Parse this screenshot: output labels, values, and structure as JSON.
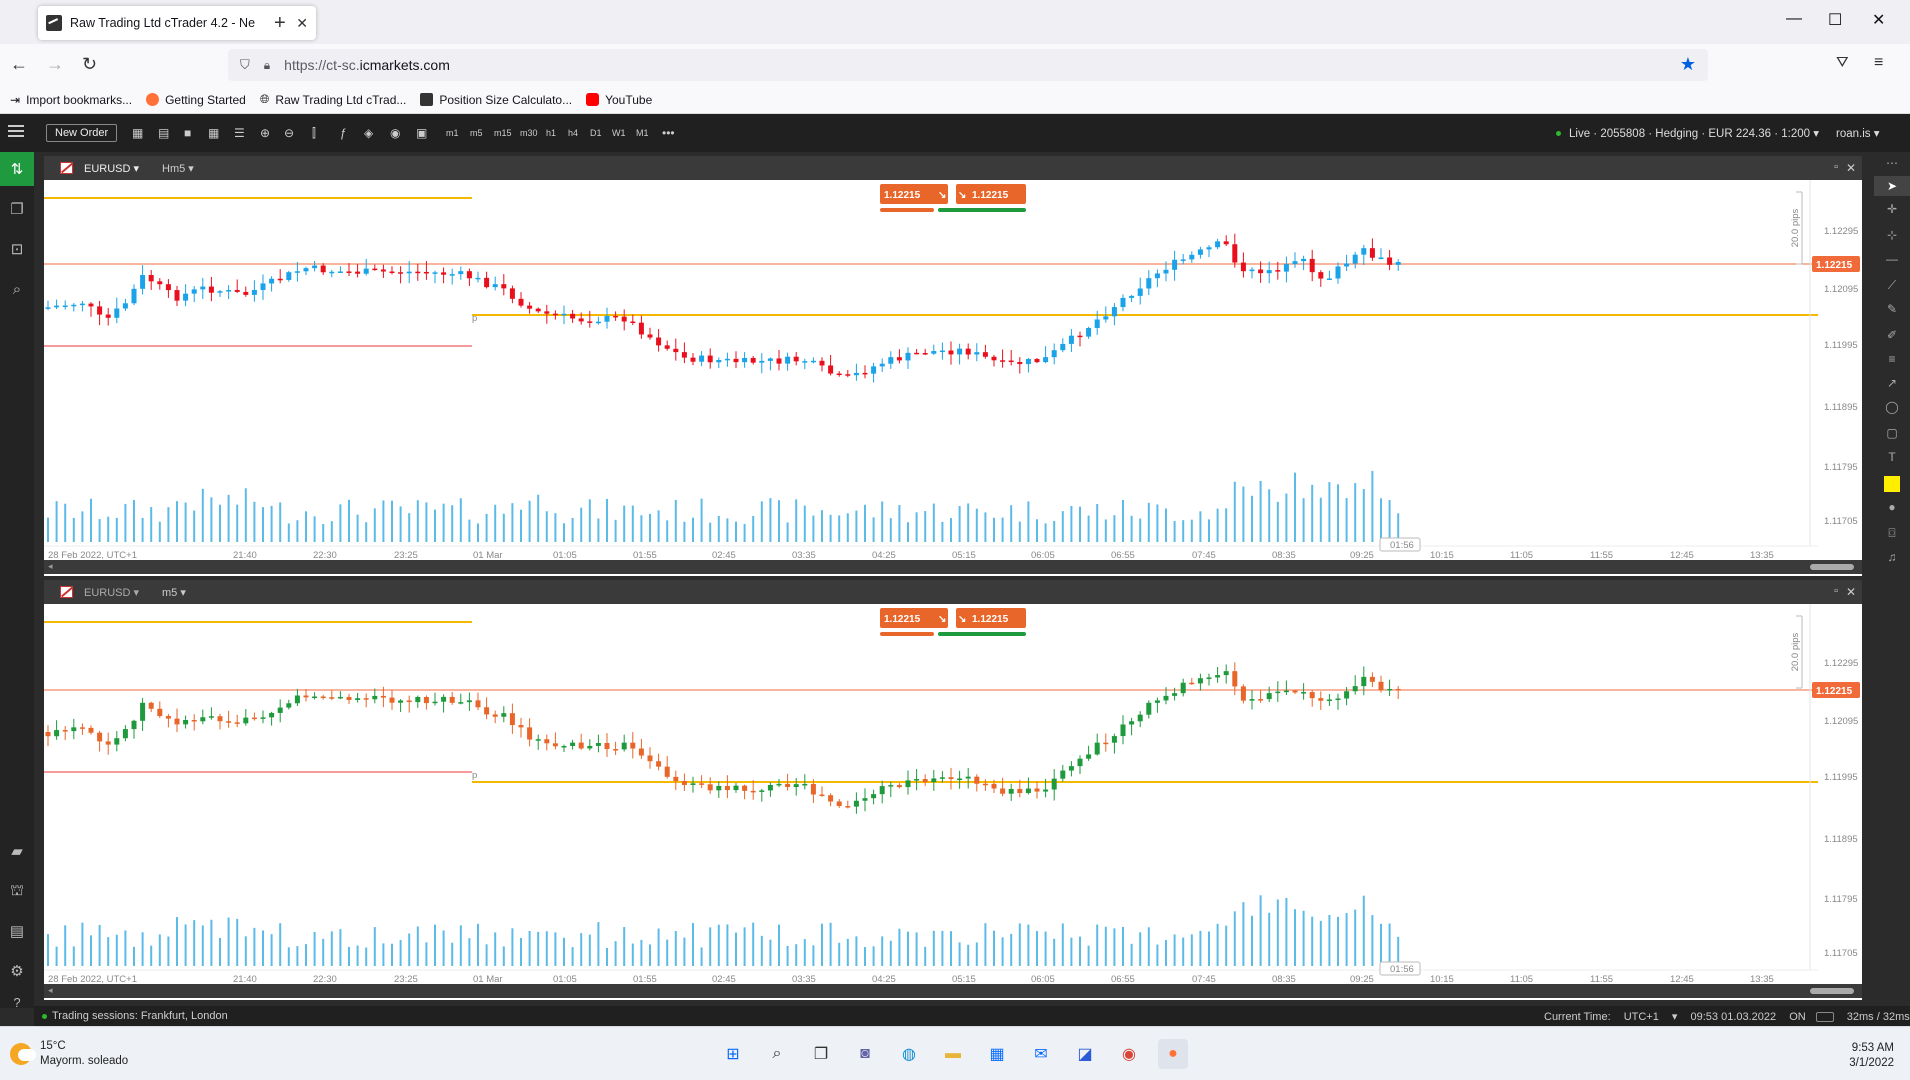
{
  "browser": {
    "tab_title": "Raw Trading Ltd cTrader 4.2 - Ne",
    "url_prefix": "https://ct-sc.",
    "url_domain": "icmarkets.com",
    "bookmarks": [
      "Import bookmarks...",
      "Getting Started",
      "Raw Trading Ltd cTrad...",
      "Position Size Calculato...",
      "YouTube"
    ]
  },
  "toolbar": {
    "new_order": "New Order",
    "timeframes": [
      "m1",
      "m5",
      "m15",
      "m30",
      "h1",
      "h4",
      "D1",
      "W1",
      "M1"
    ],
    "more": "•••",
    "account": "Live · 2055808 · Hedging · EUR 224.36 · 1:200",
    "user": "roan.is"
  },
  "charts": [
    {
      "symbol": "EURUSD",
      "timeframe": "Hm5",
      "bid_box": "1.12215",
      "ask_box": "1.12215",
      "current_price": "1.12215",
      "pips_label": "20.0 pips",
      "countdown": "01:56",
      "date_label": "28 Feb 2022, UTC+1",
      "price_ticks": [
        "1.12295",
        "1.12095",
        "1.11995",
        "1.11895",
        "1.11795",
        "1.11705"
      ],
      "time_ticks": [
        "21:40",
        "22:30",
        "23:25",
        "01 Mar",
        "01:05",
        "01:55",
        "02:45",
        "03:35",
        "04:25",
        "05:15",
        "06:05",
        "06:55",
        "07:45",
        "08:35",
        "09:25",
        "10:15",
        "11:05",
        "11:55",
        "12:45",
        "13:35"
      ],
      "style": "heikin"
    },
    {
      "symbol": "EURUSD",
      "timeframe": "m5",
      "bid_box": "1.12215",
      "ask_box": "1.12215",
      "current_price": "1.12215",
      "pips_label": "20.0 pips",
      "countdown": "01:56",
      "date_label": "28 Feb 2022, UTC+1",
      "price_ticks": [
        "1.12295",
        "1.12095",
        "1.11995",
        "1.11895",
        "1.11795",
        "1.11705"
      ],
      "time_ticks": [
        "21:40",
        "22:30",
        "23:25",
        "01 Mar",
        "01:05",
        "01:55",
        "02:45",
        "03:35",
        "04:25",
        "05:15",
        "06:05",
        "06:55",
        "07:45",
        "08:35",
        "09:25",
        "10:15",
        "11:05",
        "11:55",
        "12:45",
        "13:35"
      ],
      "style": "candles"
    }
  ],
  "status": {
    "sessions": "Trading sessions: Frankfurt, London",
    "current_time_label": "Current Time:",
    "tz": "UTC+1",
    "time": "09:53 01.03.2022",
    "on": "ON",
    "latency": "32ms / 32ms"
  },
  "taskbar": {
    "temp": "15°C",
    "weather": "Mayorm. soleado",
    "clock_time": "9:53 AM",
    "clock_date": "3/1/2022"
  },
  "colors": {
    "bull_heikin": "#1aa3e8",
    "bear_heikin": "#e8101c",
    "bull_candle": "#1e9a3c",
    "bear_candle": "#e8662a",
    "volume": "#5bbbe8",
    "level_line": "#f5b800",
    "price_line": "#f06a3a"
  }
}
